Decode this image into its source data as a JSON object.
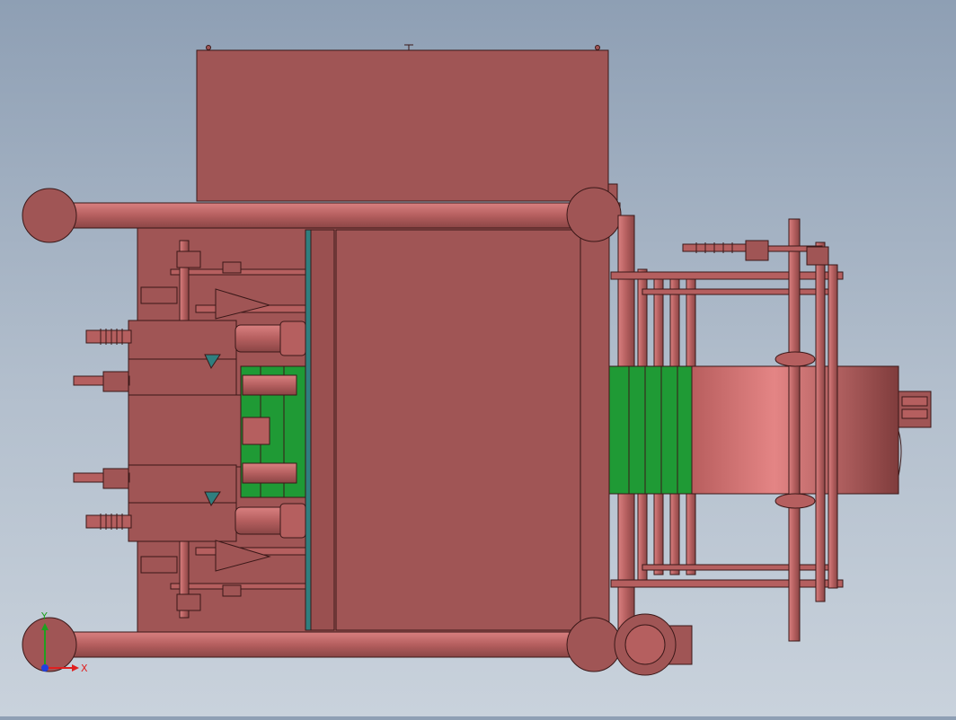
{
  "viewport": {
    "name": "3D model view",
    "colors": {
      "background_top": "#8e9fb4",
      "background_bottom": "#c9d2dc",
      "part_body": "#a05555",
      "part_light": "#c56d6d",
      "part_dark": "#7a3a3a",
      "outline": "#3a1818",
      "belt_green": "#1f9a35",
      "accent_teal": "#2f7f7f"
    }
  },
  "triad": {
    "x_label": "X",
    "y_label": "Y",
    "colors": {
      "x": "#e02020",
      "y": "#20a020",
      "z": "#2040e0"
    }
  }
}
